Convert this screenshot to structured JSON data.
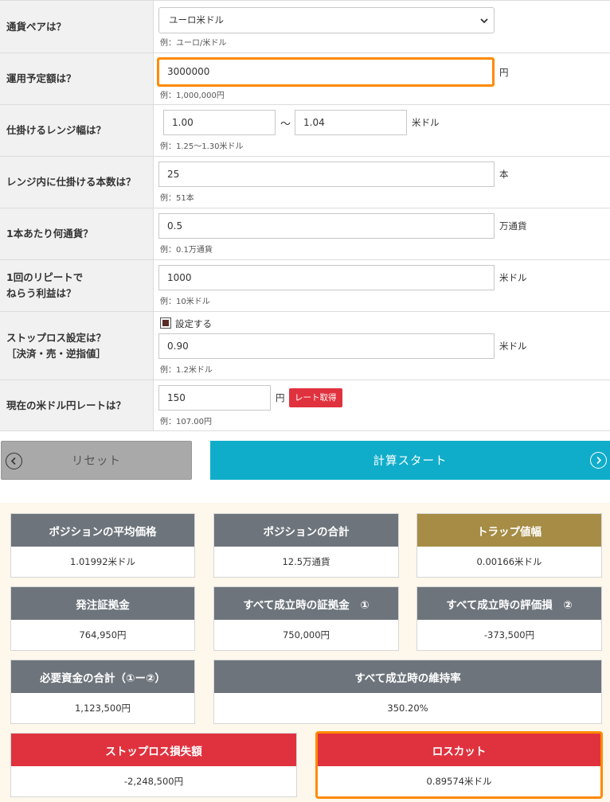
{
  "form": {
    "pair": {
      "label": "通貨ペアは？",
      "value": "ユーロ米ドル",
      "example": "例：ユーロ/米ドル"
    },
    "capital": {
      "label": "運用予定額は？",
      "value": "3000000",
      "unit": "円",
      "example": "例：1,000,000円"
    },
    "range": {
      "label": "仕掛けるレンジ幅は？",
      "low": "1.00",
      "high": "1.04",
      "tilde": "〜",
      "unit": "米ドル",
      "example": "例：1.25〜1.30米ドル"
    },
    "count": {
      "label": "レンジ内に仕掛ける本数は？",
      "value": "25",
      "unit": "本",
      "example": "例：51本"
    },
    "lot": {
      "label": "1本あたり何通貨？",
      "value": "0.5",
      "unit": "万通貨",
      "example": "例：0.1万通貨"
    },
    "profit": {
      "label_line1": "1回のリピートで",
      "label_line2": "ねらう利益は？",
      "value": "1000",
      "unit": "米ドル",
      "example": "例：10米ドル"
    },
    "stoploss": {
      "label_line1": "ストップロス設定は？",
      "label_line2": "［決済・売・逆指値］",
      "checkbox_label": "設定する",
      "checked": true,
      "value": "0.90",
      "unit": "米ドル",
      "example": "例：1.2米ドル"
    },
    "rate": {
      "label": "現在の米ドル円レートは？",
      "value": "150",
      "unit": "円",
      "button": "レート取得",
      "example": "例：107.00円"
    }
  },
  "actions": {
    "reset": "リセット",
    "start": "計算スタート"
  },
  "results": {
    "avg_price": {
      "title": "ポジションの平均価格",
      "value": "1.01992米ドル"
    },
    "position_total": {
      "title": "ポジションの合計",
      "value": "12.5万通貨"
    },
    "trap_width": {
      "title": "トラップ値幅",
      "value": "0.00166米ドル"
    },
    "order_margin": {
      "title": "発注証拠金",
      "value": "764,950円"
    },
    "all_fill_margin": {
      "title": "すべて成立時の証拠金　①",
      "value": "750,000円"
    },
    "all_fill_eval_loss": {
      "title": "すべて成立時の評価損　②",
      "value": "-373,500円"
    },
    "required_total": {
      "title": "必要資金の合計（①ー②）",
      "value": "1,123,500円"
    },
    "maintenance_rate": {
      "title": "すべて成立時の維持率",
      "value": "350.20%"
    },
    "stoploss_amount": {
      "title": "ストップロス損失額",
      "value": "-2,248,500円"
    },
    "losscut": {
      "title": "ロスカット",
      "value": "0.89574米ドル"
    }
  },
  "colors": {
    "header_gray": "#6d747b",
    "header_gold": "#a68c44",
    "header_red": "#e0323e",
    "accent_cyan": "#10adcb",
    "highlight_orange": "#ff8a00"
  }
}
